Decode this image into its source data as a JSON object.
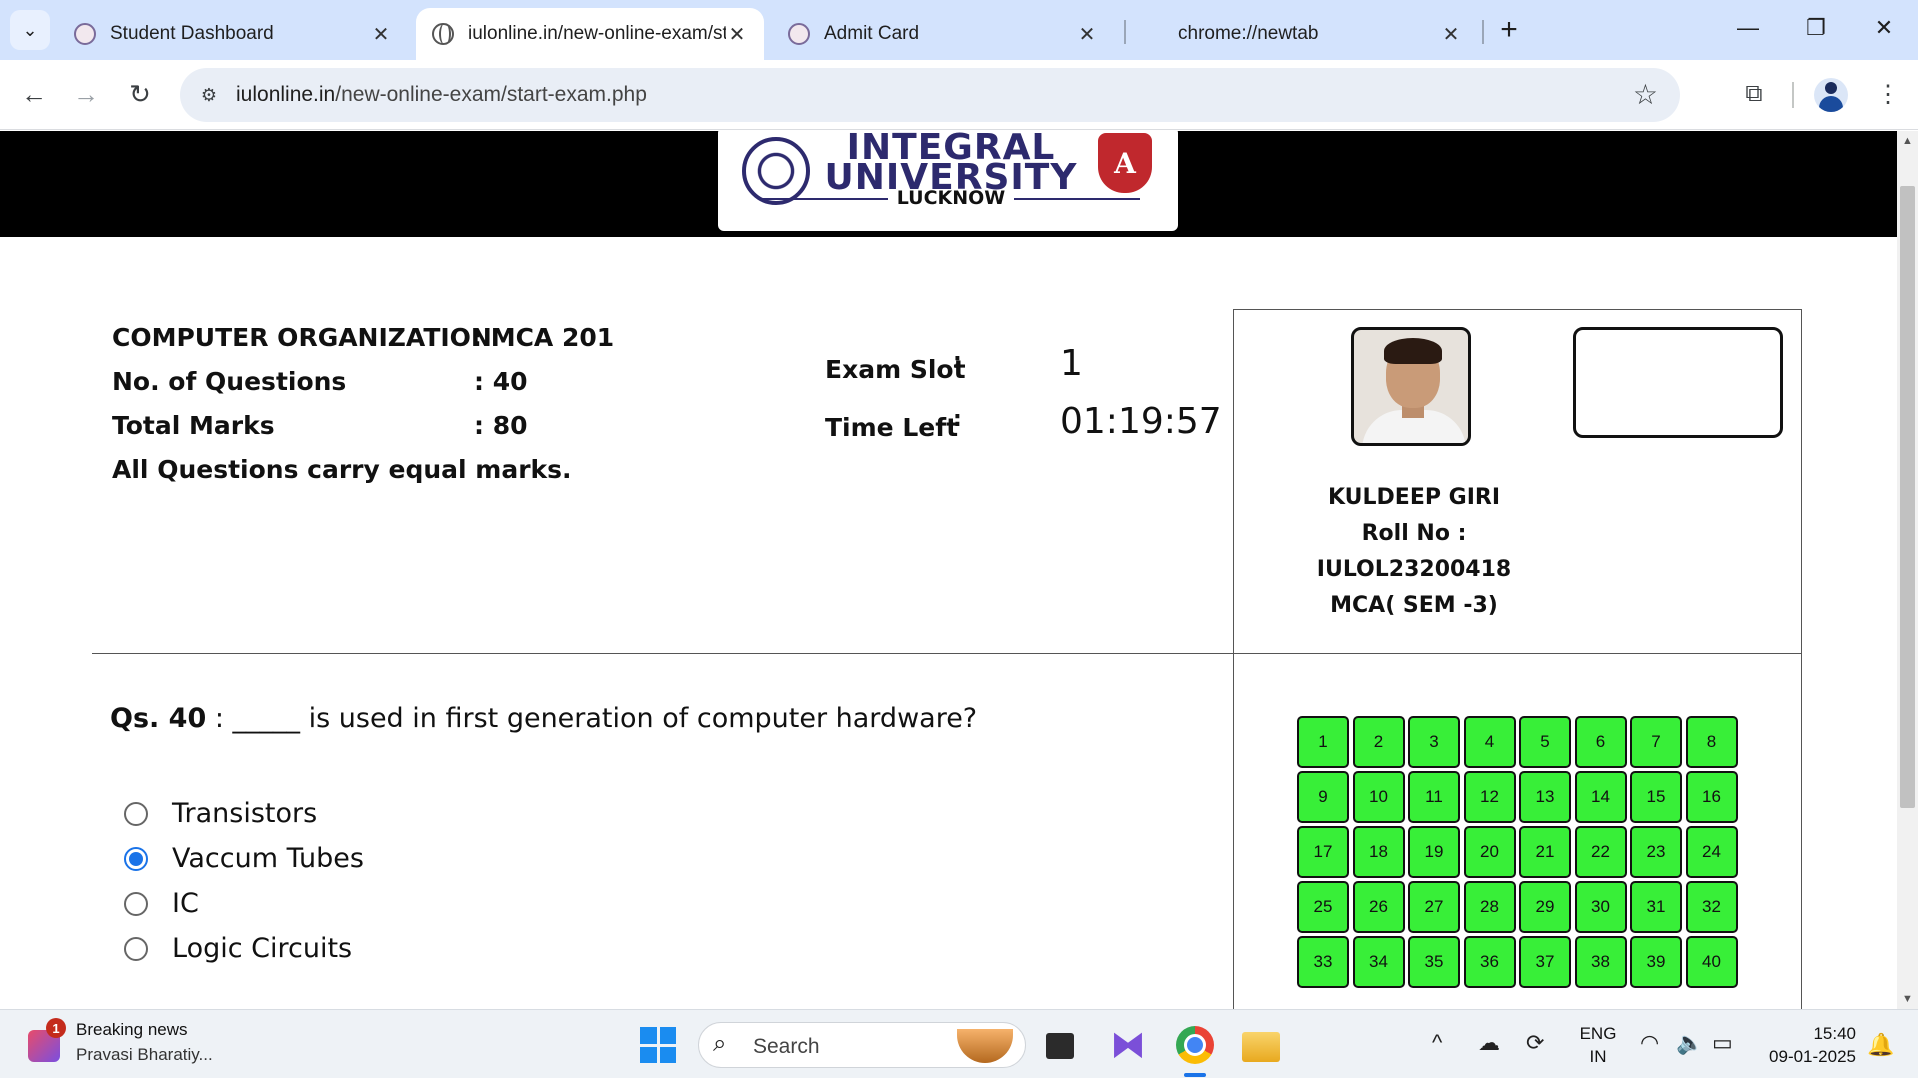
{
  "browser": {
    "tabs": [
      {
        "title": "Student Dashboard",
        "favicon": "iul-seal-icon",
        "active": false
      },
      {
        "title": "iulonline.in/new-online-exam/st",
        "favicon": "globe-icon",
        "active": true
      },
      {
        "title": "Admit Card",
        "favicon": "iul-seal-icon",
        "active": false
      },
      {
        "title": "chrome://newtab",
        "favicon": "",
        "active": false
      }
    ],
    "url_host": "iulonline.in",
    "url_path": "/new-online-exam/start-exam.php"
  },
  "header": {
    "logo_line1": "INTEGRAL",
    "logo_line2": "UNIVERSITY",
    "logo_sub": "LUCKNOW",
    "badge_letter": "A"
  },
  "exam": {
    "subject_label": "COMPUTER ORGANIZATION",
    "subject_code": ": MCA 201",
    "questions_label": "No. of Questions",
    "questions_value": ": 40",
    "marks_label": "Total Marks",
    "marks_value": ": 80",
    "note": "All Questions carry equal marks.",
    "slot_label": "Exam Slot",
    "slot_value": "1",
    "time_label": "Time Left",
    "time_value": "01:19:57"
  },
  "student": {
    "name": "KULDEEP GIRI",
    "roll_label": "Roll No :",
    "roll_no": "IULOL23200418",
    "program": "MCA( SEM -3)"
  },
  "question": {
    "number_label": "Qs. 40",
    "separator": " : ",
    "text": "_____ is used in first generation of computer hardware?",
    "options": [
      {
        "label": "Transistors",
        "selected": false
      },
      {
        "label": "Vaccum Tubes",
        "selected": true
      },
      {
        "label": "IC",
        "selected": false
      },
      {
        "label": "Logic Circuits",
        "selected": false
      }
    ]
  },
  "question_nav": [
    "1",
    "2",
    "3",
    "4",
    "5",
    "6",
    "7",
    "8",
    "9",
    "10",
    "11",
    "12",
    "13",
    "14",
    "15",
    "16",
    "17",
    "18",
    "19",
    "20",
    "21",
    "22",
    "23",
    "24",
    "25",
    "26",
    "27",
    "28",
    "29",
    "30",
    "31",
    "32",
    "33",
    "34",
    "35",
    "36",
    "37",
    "38",
    "39",
    "40"
  ],
  "colors": {
    "answered": "#38ef38",
    "accent": "#1a73e8",
    "brand": "#2d2a6e"
  },
  "taskbar": {
    "news_badge": "1",
    "news_title": "Breaking news",
    "news_sub": "Pravasi Bharatiy...",
    "search_placeholder": "Search",
    "lang_line1": "ENG",
    "lang_line2": "IN",
    "time": "15:40",
    "date": "09-01-2025"
  }
}
